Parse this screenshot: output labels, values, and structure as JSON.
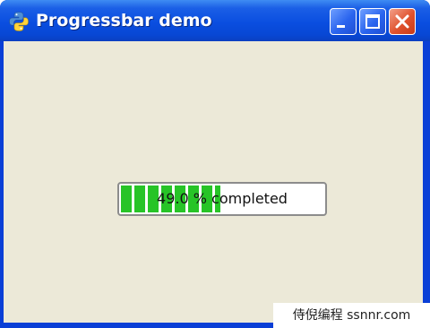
{
  "window": {
    "title": "Progressbar demo",
    "icon": "python-icon",
    "controls": [
      "minimize-icon",
      "maximize-icon",
      "close-icon"
    ]
  },
  "progress": {
    "value": 49.0,
    "text": "49.0 % completed",
    "fill_color": "#27c427"
  },
  "watermark": {
    "text": "侍倪编程 ssnnr.com"
  },
  "colors": {
    "titlebar": "#0a4ee0",
    "client_bg": "#ece9d8",
    "close_button": "#e0522e"
  }
}
